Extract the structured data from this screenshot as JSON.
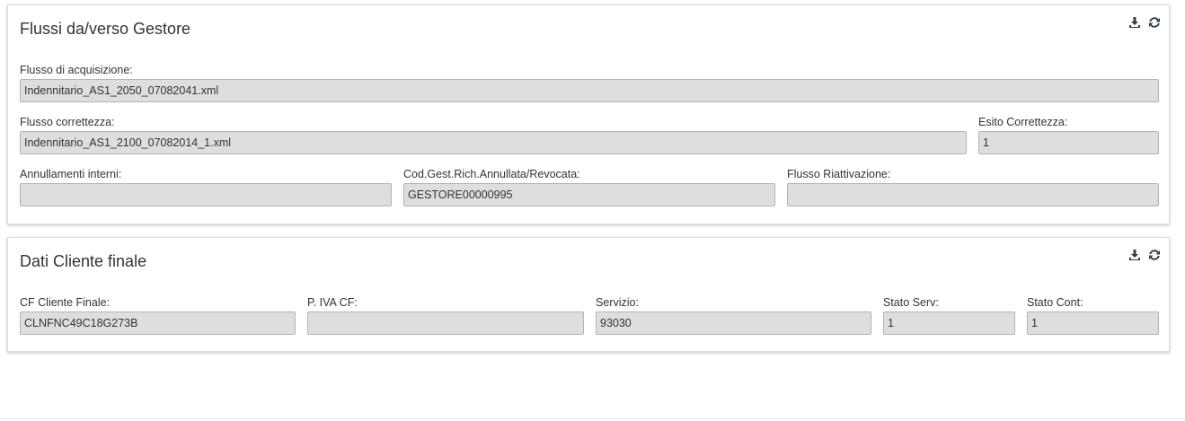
{
  "flussi": {
    "title": "Flussi da/verso Gestore",
    "fields": {
      "flusso_acquisizione": {
        "label": "Flusso di acquisizione:",
        "value": "Indennitario_AS1_2050_07082041.xml"
      },
      "flusso_correttezza": {
        "label": "Flusso correttezza:",
        "value": "Indennitario_AS1_2100_07082014_1.xml"
      },
      "esito_correttezza": {
        "label": "Esito Correttezza:",
        "value": "1"
      },
      "annullamenti_interni": {
        "label": "Annullamenti interni:",
        "value": ""
      },
      "cod_gest": {
        "label": "Cod.Gest.Rich.Annullata/Revocata:",
        "value": "GESTORE00000995"
      },
      "flusso_riattivazione": {
        "label": "Flusso Riattivazione:",
        "value": ""
      }
    },
    "tools": [
      "download-icon",
      "refresh-icon"
    ]
  },
  "cliente": {
    "title": "Dati Cliente finale",
    "fields": {
      "cf_cliente": {
        "label": "CF Cliente Finale:",
        "value": "CLNFNC49C18G273B"
      },
      "piva_cf": {
        "label": "P. IVA CF:",
        "value": ""
      },
      "servizio": {
        "label": "Servizio:",
        "value": "93030"
      },
      "stato_serv": {
        "label": "Stato Serv:",
        "value": "1"
      },
      "stato_cont": {
        "label": "Stato Cont:",
        "value": "1"
      }
    },
    "tools": [
      "download-icon",
      "refresh-icon"
    ]
  },
  "colors": {
    "input_bg": "#dedede",
    "input_border": "#b4b4b4",
    "text": "#333333",
    "icon": "#2f3e4e"
  }
}
